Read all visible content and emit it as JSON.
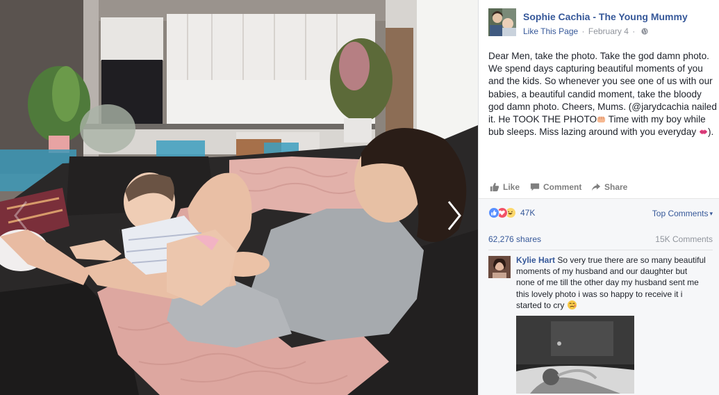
{
  "photo": {
    "alt_subject": "photo",
    "prev_icon": "chevron-left-icon",
    "next_icon": "chevron-right-icon"
  },
  "post": {
    "page_name": "Sophie Cachia - The Young Mummy",
    "like_page": "Like This Page",
    "separator": "·",
    "date": "February 4",
    "separator2": "·",
    "privacy_icon": "globe-icon",
    "text_1": "Dear Men, take the photo. Take the god damn photo. We spend days capturing beautiful moments of you and the kids. So whenever you see one of us with our babies, a beautiful candid moment, take the bloody god damn photo. Cheers, Mums. (@jarydcachia nailed it. He TOOK THE PHOTO",
    "emoji_1": "fist-emoji",
    "text_2": " Time with my boy while bub sleeps. Miss lazing around with you everyday ",
    "emoji_2": "kiss-lips-emoji",
    "text_3": ")."
  },
  "actions": {
    "like": "Like",
    "comment": "Comment",
    "share": "Share"
  },
  "feedback": {
    "reaction_count": "47K",
    "top_comments": "Top Comments",
    "top_comments_arrow": "▾",
    "shares": "62,276 shares",
    "comments": "15K Comments"
  },
  "comment": {
    "author": "Kylie Hart",
    "text": " So very true there are so many beautiful moments of my husband and our daughter but none of me till the other day my husband sent me this lovely photo i was so happy to receive it i started to cry ",
    "emoji": "crying-face-emoji"
  },
  "colors": {
    "link": "#365899",
    "muted": "#90949c",
    "like_blue": "#5890ff",
    "love_red": "#f25268",
    "haha_yellow": "#fcd86c"
  }
}
